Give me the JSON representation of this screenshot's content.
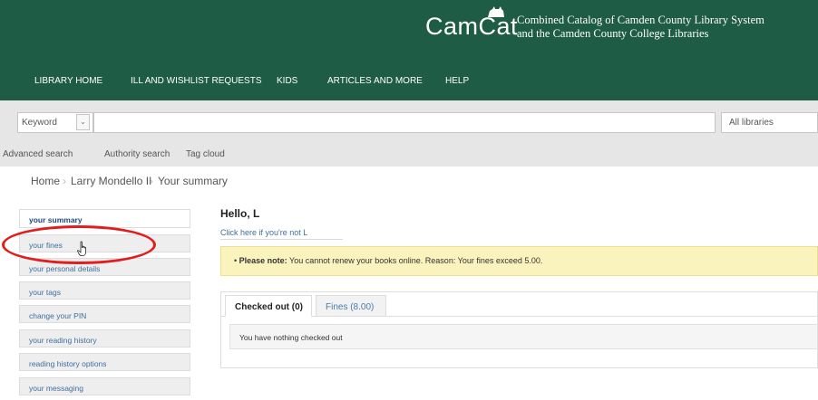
{
  "header": {
    "logo_text": "CamCat",
    "subtitle_line1": "Combined Catalog of Camden County Library System",
    "subtitle_line2": "and the Camden County College Libraries",
    "bg_color": "#1e5c46"
  },
  "nav": {
    "items": [
      {
        "label": "LIBRARY HOME"
      },
      {
        "label": "ILL AND WISHLIST REQUESTS"
      },
      {
        "label": "KIDS"
      },
      {
        "label": "ARTICLES AND MORE"
      },
      {
        "label": "HELP"
      }
    ]
  },
  "search": {
    "type_value": "Keyword",
    "query_value": "",
    "library_value": "All libraries"
  },
  "sub_links": [
    {
      "label": "Advanced search"
    },
    {
      "label": "Authority search"
    },
    {
      "label": "Tag cloud"
    }
  ],
  "breadcrumb": [
    {
      "label": "Home"
    },
    {
      "label": "Larry Mondello II"
    },
    {
      "label": "Your summary"
    }
  ],
  "sidebar": {
    "items": [
      {
        "label": "your summary",
        "active": true
      },
      {
        "label": "your fines"
      },
      {
        "label": "your personal details"
      },
      {
        "label": "your tags"
      },
      {
        "label": "change your PIN"
      },
      {
        "label": "your reading history"
      },
      {
        "label": "reading history options"
      },
      {
        "label": "your messaging"
      }
    ]
  },
  "main": {
    "greeting": "Hello, L",
    "not_you_link": "Click here if you're not L",
    "alert_bold": "Please note:",
    "alert_text": "You cannot renew your books online. Reason: Your fines exceed 5.00.",
    "tabs": [
      {
        "label": "Checked out (0)",
        "active": true
      },
      {
        "label": "Fines (8.00)"
      }
    ],
    "empty_message": "You have nothing checked out"
  },
  "colors": {
    "alert_bg": "#fbf3bd",
    "link": "#3f6f9e",
    "highlight": "#e01e1e"
  },
  "icons": {
    "pointer": "hand-pointer-icon",
    "logo_cat": "cat-logo-icon"
  }
}
